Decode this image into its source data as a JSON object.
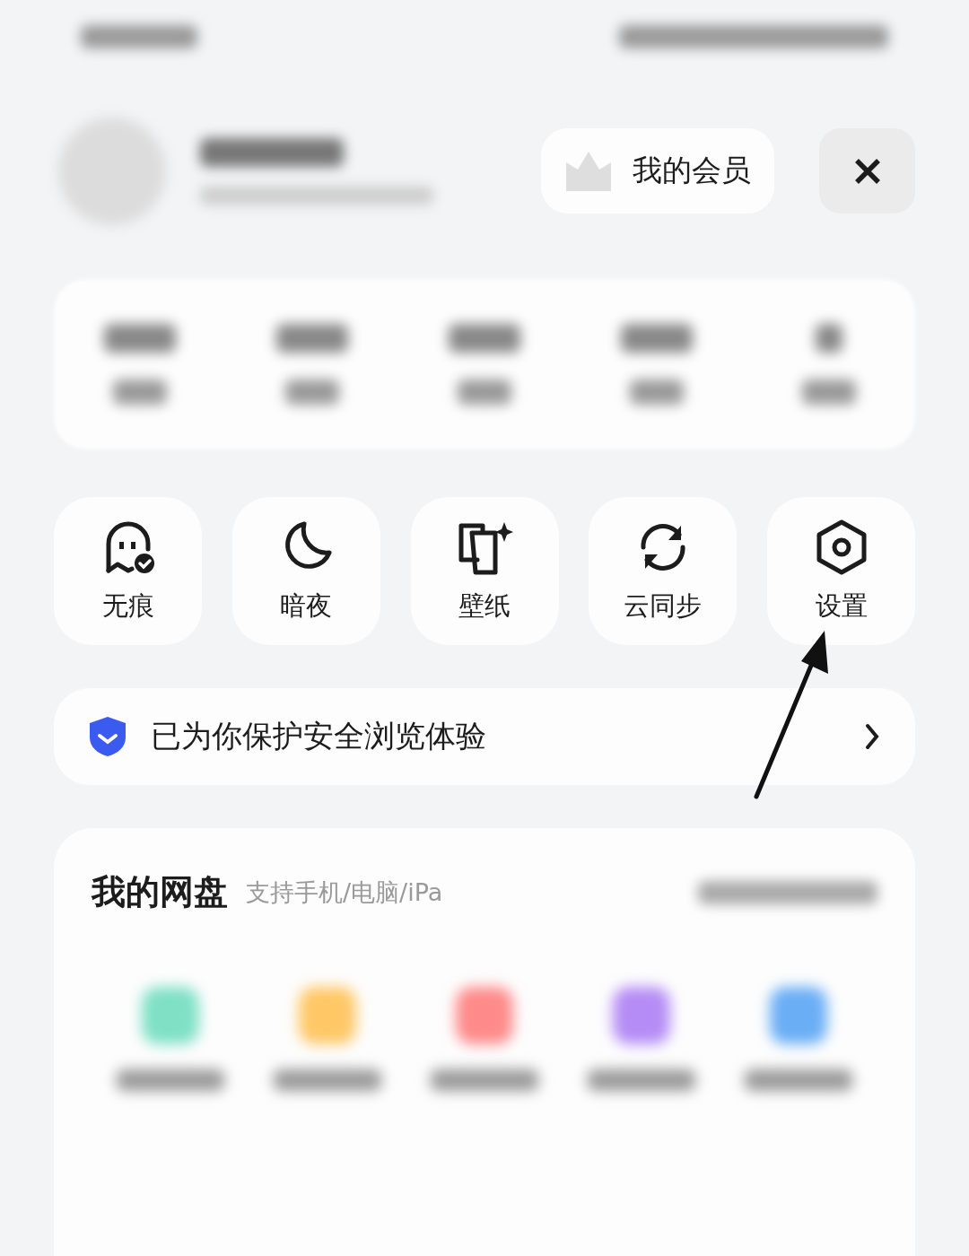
{
  "member_button": {
    "label": "我的会员"
  },
  "shortcuts": [
    {
      "kind": "ghost",
      "label": "无痕"
    },
    {
      "kind": "moon",
      "label": "暗夜"
    },
    {
      "kind": "wallpaper",
      "label": "壁纸"
    },
    {
      "kind": "sync",
      "label": "云同步"
    },
    {
      "kind": "settings",
      "label": "设置"
    }
  ],
  "security_banner": {
    "text": "已为你保护安全浏览体验"
  },
  "cloud_disk": {
    "title": "我的网盘",
    "subtitle": "支持手机/电脑/iPa"
  }
}
